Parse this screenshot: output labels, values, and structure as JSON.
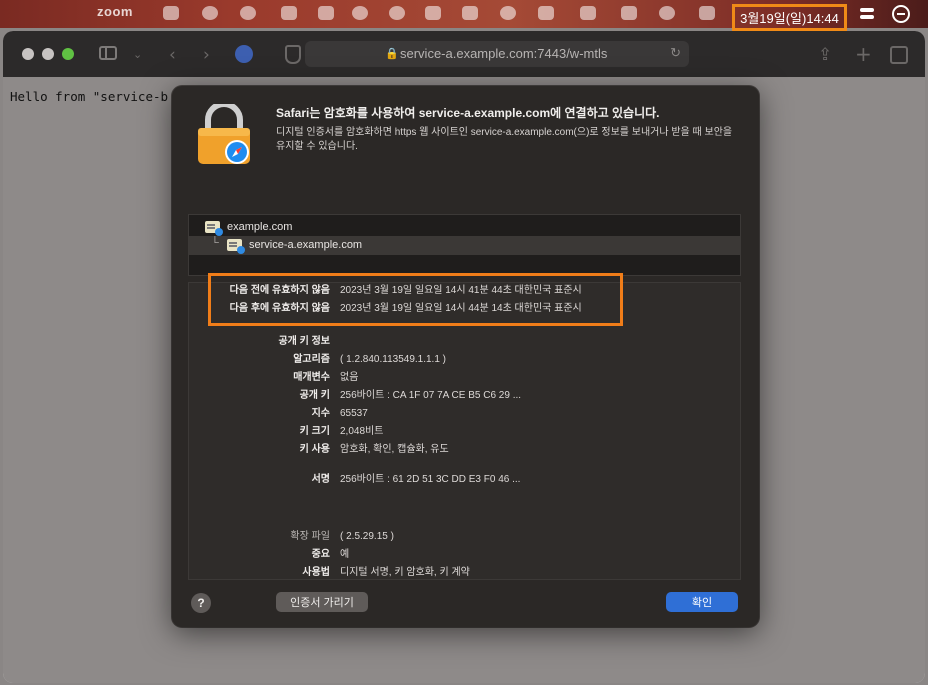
{
  "menubar": {
    "app_label": "zoom",
    "datetime": "3월19일(일)14:44"
  },
  "browser": {
    "address": "service-a.example.com:7443/w-mtls",
    "page_text": "Hello from \"service-b"
  },
  "sheet": {
    "title": "Safari는 암호화를 사용하여 service-a.example.com에 연결하고 있습니다.",
    "description": "디지털 인증서를 암호화하면 https 웹 사이트인 service-a.example.com(으)로 정보를 보내거나 받을 때 보안을 유지할 수 있습니다.",
    "tree": [
      {
        "label": "example.com"
      },
      {
        "label": "service-a.example.com"
      }
    ],
    "details": {
      "not_before_label": "다음 전에 유효하지 않음",
      "not_before_value": "2023년 3월 19일 일요일 14시 41분 44초 대한민국 표준시",
      "not_after_label": "다음 후에 유효하지 않음",
      "not_after_value": "2023년 3월 19일 일요일 14시 44분 14초 대한민국 표준시",
      "public_key_info_label": "공개 키 정보",
      "algorithm_label": "알고리즘",
      "algorithm_value": "( 1.2.840.113549.1.1.1 )",
      "parameters_label": "매개변수",
      "parameters_value": "없음",
      "public_key_label": "공개 키",
      "public_key_value": "256바이트 : CA 1F 07 7A CE B5 C6 29 ...",
      "exponent_label": "지수",
      "exponent_value": "65537",
      "key_size_label": "키 크기",
      "key_size_value": "2,048비트",
      "key_usage_label": "키 사용",
      "key_usage_value": "암호화, 확인, 캡슐화, 유도",
      "signature_label": "서명",
      "signature_value": "256바이트 : 61 2D 51 3C DD E3 F0 46 ...",
      "extension_label": "확장 파일",
      "extension_value": "( 2.5.29.15 )",
      "critical_label": "중요",
      "critical_value": "예",
      "usage_label": "사용법",
      "usage_value": "디지털 서명, 키 암호화, 키 계약"
    },
    "help_label": "?",
    "hide_cert_label": "인증서 가리기",
    "ok_label": "확인"
  },
  "colors": {
    "highlight": "#f07d19",
    "primary_button": "#2f6fd6"
  }
}
